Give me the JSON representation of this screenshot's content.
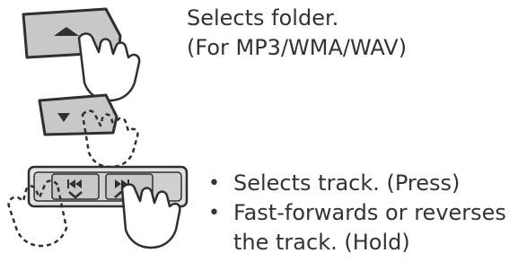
{
  "folder_control": {
    "description_line1": "Selects folder.",
    "description_line2": "(For MP3/WMA/WAV)",
    "up_icon": "triangle-up-icon",
    "down_icon": "triangle-down-icon"
  },
  "track_control": {
    "bullet_symbol": "•",
    "bullets": [
      {
        "lines": [
          "Selects track. (Press)"
        ]
      },
      {
        "lines": [
          "Fast-forwards or reverses",
          "the track. (Hold)"
        ]
      }
    ],
    "prev_icon": "skip-previous-icon",
    "next_icon": "skip-next-icon"
  },
  "colors": {
    "button_face": "#c8c8c8",
    "button_edge": "#3a3a3a",
    "panel": "#e0e0e0",
    "text": "#333333"
  }
}
